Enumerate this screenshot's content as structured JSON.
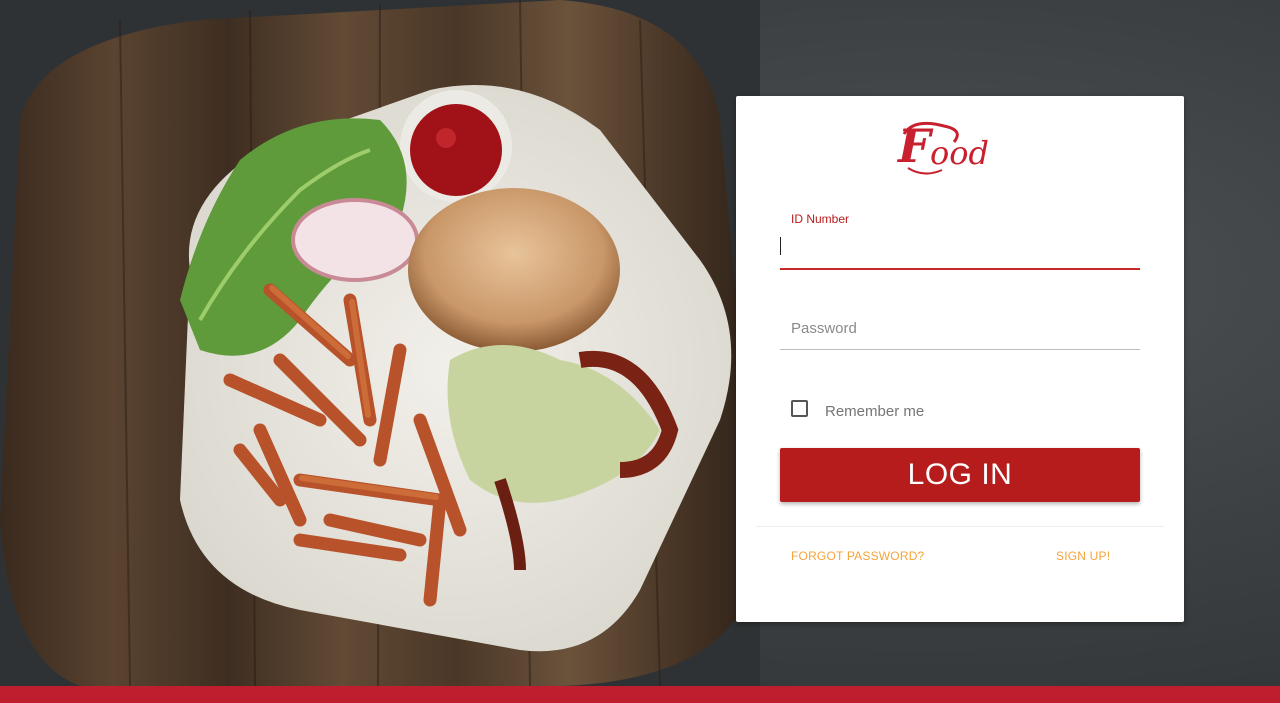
{
  "brand": {
    "logo_text": "Food",
    "logo_color": "#c8202e"
  },
  "form": {
    "id_number": {
      "label": "ID Number",
      "value": ""
    },
    "password": {
      "placeholder": "Password",
      "value": ""
    },
    "remember_me": {
      "label": "Remember me",
      "checked": false
    },
    "login_label": "LOG IN",
    "forgot_password_label": "FORGOT PASSWORD?",
    "signup_label": "SIGN UP!"
  },
  "colors": {
    "primary": "#b71c1c",
    "link": "#f6a33a",
    "bottom_bar": "#be1e2d"
  },
  "background": {
    "icon": "food-photo"
  }
}
